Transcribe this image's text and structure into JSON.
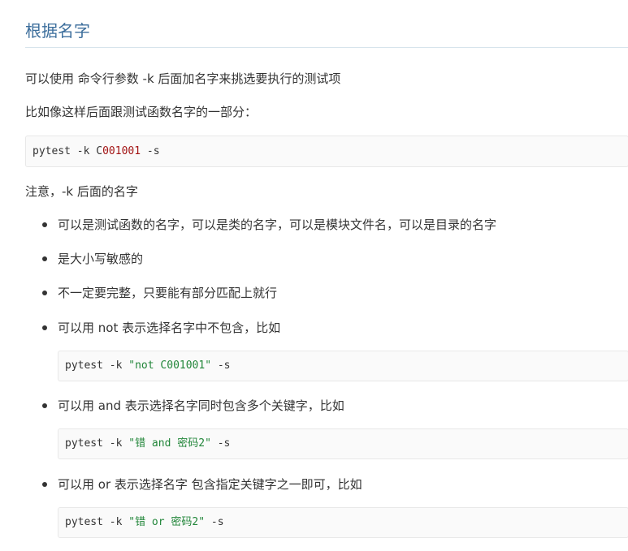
{
  "heading": "根据名字",
  "intro": "可以使用 命令行参数 -k 后面加名字来挑选要执行的测试项",
  "example_intro": "比如像这样后面跟测试函数名字的一部分：",
  "code1": {
    "pre": "pytest -k C",
    "num": "001001",
    "post": " -s"
  },
  "note": "注意，-k 后面的名字",
  "items": [
    "可以是测试函数的名字，可以是类的名字，可以是模块文件名，可以是目录的名字",
    "是大小写敏感的",
    "不一定要完整，只要能有部分匹配上就行",
    "可以用 not 表示选择名字中不包含，比如",
    "可以用 and 表示选择名字同时包含多个关键字，比如",
    "可以用 or 表示选择名字 包含指定关键字之一即可，比如"
  ],
  "code_not": {
    "pre": "pytest -k ",
    "str": "\"not C001001\"",
    "post": " -s"
  },
  "code_and": {
    "pre": "pytest -k ",
    "str": "\"错 and 密码2\"",
    "post": " -s"
  },
  "code_or": {
    "pre": "pytest -k ",
    "str": "\"错 or 密码2\"",
    "post": " -s"
  }
}
